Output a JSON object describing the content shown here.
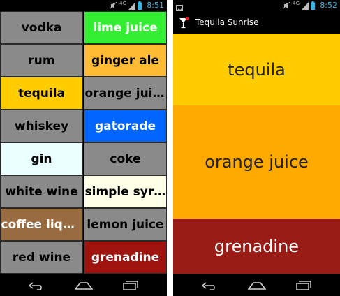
{
  "status_bar_left": {
    "time": "8:51",
    "network": "4G"
  },
  "status_bar_right": {
    "time": "8:52",
    "network": "4G"
  },
  "drink_list": {
    "left_column": [
      {
        "label": "vodka",
        "bg": "#8a8a8a",
        "fg": "#000000"
      },
      {
        "label": "rum",
        "bg": "#8a8a8a",
        "fg": "#000000"
      },
      {
        "label": "tequila",
        "bg": "#ffcc00",
        "fg": "#000000"
      },
      {
        "label": "whiskey",
        "bg": "#8a8a8a",
        "fg": "#000000"
      },
      {
        "label": "gin",
        "bg": "#eaffff",
        "fg": "#000000"
      },
      {
        "label": "white wine",
        "bg": "#8a8a8a",
        "fg": "#000000"
      },
      {
        "label": "coffee liqu...",
        "bg": "#996b40",
        "fg": "#ffffff"
      },
      {
        "label": "red wine",
        "bg": "#8a8a8a",
        "fg": "#000000"
      }
    ],
    "right_column": [
      {
        "label": "lime juice",
        "bg": "#33ee33",
        "fg": "#ffffff"
      },
      {
        "label": "ginger ale",
        "bg": "#ffbb33",
        "fg": "#000000"
      },
      {
        "label": "orange juice",
        "bg": "#8a8a8a",
        "fg": "#000000"
      },
      {
        "label": "gatorade",
        "bg": "#0066ff",
        "fg": "#ffffff"
      },
      {
        "label": "coke",
        "bg": "#8a8a8a",
        "fg": "#000000"
      },
      {
        "label": "simple syrup",
        "bg": "#ffffe8",
        "fg": "#000000"
      },
      {
        "label": "lemon juice",
        "bg": "#8a8a8a",
        "fg": "#000000"
      },
      {
        "label": "grenadine",
        "bg": "#a0140f",
        "fg": "#ffffff"
      }
    ]
  },
  "recipe_screen": {
    "title": "Tequila Sunrise",
    "ingredients": [
      {
        "label": "tequila",
        "bg": "#ffcc00",
        "fg": "#222222",
        "share": 0.3
      },
      {
        "label": "orange juice",
        "bg": "#ffaa00",
        "fg": "#222222",
        "share": 0.47
      },
      {
        "label": "grenadine",
        "bg": "#9a1c16",
        "fg": "#ffffff",
        "share": 0.23
      }
    ]
  },
  "icons": {
    "status_notification": "image-icon",
    "status_mute": "mute-icon",
    "status_signal": "signal-icon",
    "status_battery": "battery-icon",
    "nav_back": "back-icon",
    "nav_home": "home-icon",
    "nav_recents": "recents-icon",
    "app_icon": "cocktail-glass-icon"
  }
}
